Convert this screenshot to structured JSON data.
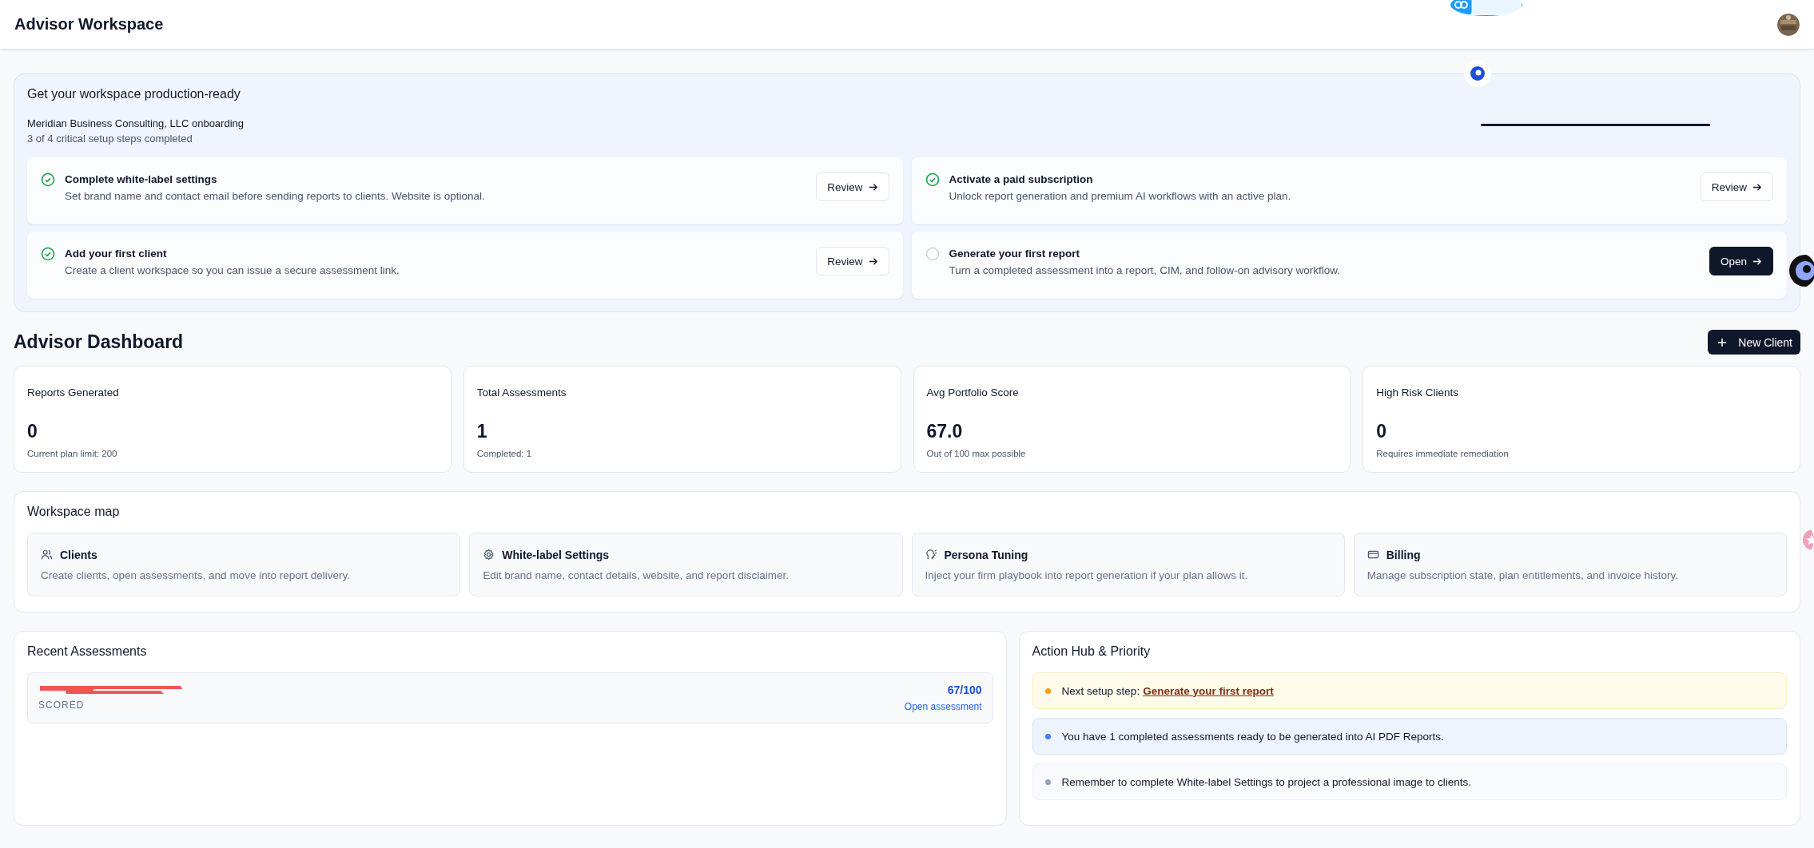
{
  "header": {
    "title": "Advisor Workspace"
  },
  "setup": {
    "title": "Get your workspace production-ready",
    "org": "Meridian Business Consulting, LLC onboarding",
    "progress_text": "3 of 4 critical setup steps completed",
    "level": 0.75,
    "steps": [
      {
        "title": "Complete white-label settings",
        "description": "Set brand name and contact email before sending reports to clients. Website is optional.",
        "done": true,
        "action": "Review",
        "primary": false
      },
      {
        "title": "Activate a paid subscription",
        "description": "Unlock report generation and premium AI workflows with an active plan.",
        "done": true,
        "action": "Review",
        "primary": false
      },
      {
        "title": "Add your first client",
        "description": "Create a client workspace so you can issue a secure assessment link.",
        "done": true,
        "action": "Review",
        "primary": false
      },
      {
        "title": "Generate your first report",
        "description": "Turn a completed assessment into a report, CIM, and follow-on advisory workflow.",
        "done": false,
        "action": "Open",
        "primary": true
      }
    ]
  },
  "dashboard": {
    "title": "Advisor Dashboard",
    "new_button": "New Client",
    "stats": [
      {
        "label": "Reports Generated",
        "value": "0",
        "note": "Current plan limit: 200"
      },
      {
        "label": "Total Assessments",
        "value": "1",
        "note": "Completed: 1"
      },
      {
        "label": "Avg Portfolio Score",
        "value": "67.0",
        "note": "Out of 100 max possible"
      },
      {
        "label": "High Risk Clients",
        "value": "0",
        "note": "Requires immediate remediation"
      }
    ]
  },
  "workspace_map": {
    "title": "Workspace map",
    "items": [
      {
        "kind": "clients",
        "title": "Clients",
        "description": "Create clients, open assessments, and move into report delivery."
      },
      {
        "kind": "settings",
        "title": "White-label Settings",
        "description": "Edit brand name, contact details, website, and report disclaimer."
      },
      {
        "kind": "persona",
        "title": "Persona Tuning",
        "description": "Inject your firm playbook into report generation if your plan allows it."
      },
      {
        "kind": "billing",
        "title": "Billing",
        "description": "Manage subscription state, plan entitlements, and invoice history."
      }
    ]
  },
  "recent": {
    "title": "Recent Assessments",
    "rows": [
      {
        "status": "SCORED",
        "score": "67/100",
        "link": "Open assessment"
      }
    ]
  },
  "action_hub": {
    "title": "Action Hub & Priority",
    "items": [
      {
        "kind": "link",
        "text": "Next setup step:",
        "link": "Generate your first report",
        "color": "#f59e0b"
      },
      {
        "kind": "plain",
        "text": "You have 1 completed assessments ready to be generated into AI PDF Reports.",
        "color": "#3b82f6"
      },
      {
        "kind": "plain",
        "text": "Remember to complete White-label Settings to project a professional image to clients.",
        "color": "#94a3b8"
      }
    ]
  }
}
